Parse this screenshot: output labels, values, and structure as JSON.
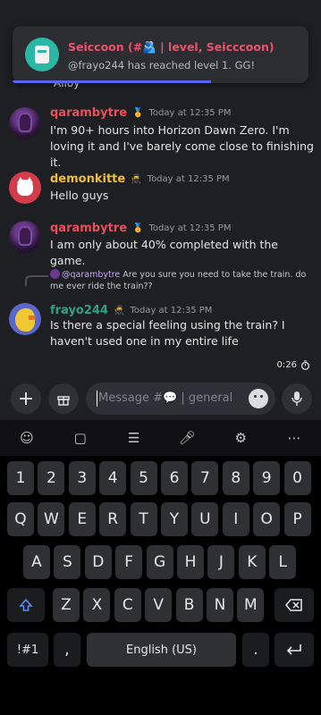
{
  "notification": {
    "title": "Seiccoon (#🫂 | level, Seicccoon)",
    "text": "@frayo244 has reached level 1. GG!"
  },
  "partial_text": "Alloy",
  "messages": [
    {
      "user": "qarambytre",
      "badge": "🏅",
      "time": "Today at 12:35 PM",
      "text": "I'm 90+ hours into Horizon Dawn Zero. I'm loving it and I've barely come close to finishing it."
    },
    {
      "user": "demonkitte",
      "badge": "🥷",
      "time": "Today at 12:35 PM",
      "text": "Hello guys"
    },
    {
      "user": "qarambytre",
      "badge": "🏅",
      "time": "Today at 12:35 PM",
      "text": "I am only about 40% completed with the game."
    },
    {
      "user": "frayo244",
      "badge": "🥷",
      "time": "Today at 12:35 PM",
      "text": "Is there a special feeling using the train? I haven't used one in my entire life"
    }
  ],
  "reply": {
    "mention": "@qarambytre",
    "text": "Are you sure you need to take the train. do me ever ride the train??"
  },
  "voice_timer": "0:26",
  "composer": {
    "placeholder": "Message #💬 | general"
  },
  "keyboard": {
    "numbers": [
      "1",
      "2",
      "3",
      "4",
      "5",
      "6",
      "7",
      "8",
      "9",
      "0"
    ],
    "row1": [
      "Q",
      "W",
      "E",
      "R",
      "T",
      "Y",
      "U",
      "I",
      "O",
      "P"
    ],
    "row2": [
      "A",
      "S",
      "D",
      "F",
      "G",
      "H",
      "J",
      "K",
      "L"
    ],
    "row3": [
      "Z",
      "X",
      "C",
      "V",
      "B",
      "N",
      "M"
    ],
    "symbols": "!#1",
    "comma": ",",
    "space": "English (US)",
    "period": "."
  },
  "colors": {
    "qarambytre": "#e94f5a",
    "demonkitte": "#f0c030",
    "frayo244": "#2fa37e",
    "notif_title": "#f0506e",
    "accent": "#5865f2"
  }
}
